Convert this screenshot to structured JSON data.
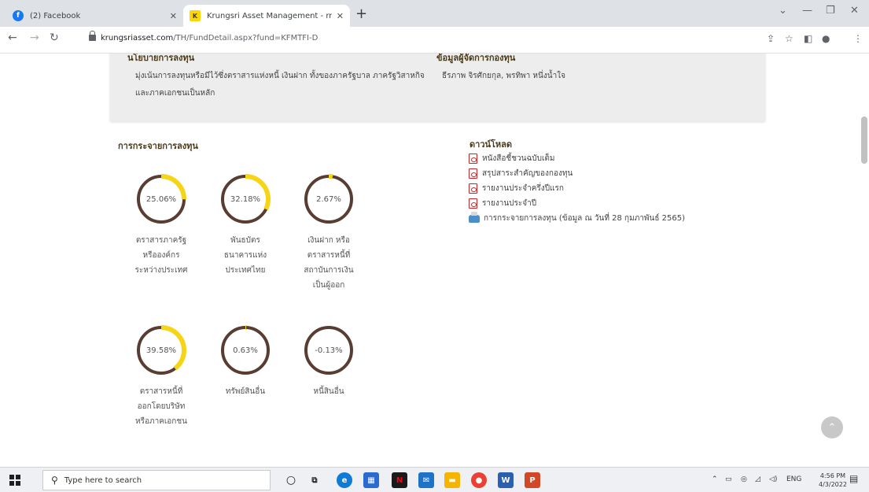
{
  "browser": {
    "tabs": [
      {
        "title": "(2) Facebook",
        "active": false
      },
      {
        "title": "Krungsri Asset Management - rr",
        "active": true
      }
    ],
    "url_host": "krungsriasset.com",
    "url_path": "/TH/FundDetail.aspx?fund=KFMTFI-D"
  },
  "policy": {
    "title": "นโยบายการลงทุน",
    "text": "มุ่งเน้นการลงทุนหรือมีไว้ซึ่งตราสารแห่งหนี้ เงินฝาก ทั้งของภาครัฐบาล ภาครัฐวิสาหกิจ และภาคเอกชนเป็นหลัก"
  },
  "manager": {
    "title": "ข้อมูลผู้จัดการกองทุน",
    "text": "ธีรภาพ จิรศักยกุล, พรทิพา หนึ่งน้ำใจ"
  },
  "allocation": {
    "title": "การกระจายการลงทุน",
    "items": [
      {
        "pct_label": "25.06%",
        "value": 25.06,
        "label_lines": [
          "ตราสารภาครัฐ",
          "หรือองค์กร",
          "ระหว่างประเทศ"
        ]
      },
      {
        "pct_label": "32.18%",
        "value": 32.18,
        "label_lines": [
          "พันธบัตร",
          "ธนาคารแห่ง",
          "ประเทศไทย"
        ]
      },
      {
        "pct_label": "2.67%",
        "value": 2.67,
        "label_lines": [
          "เงินฝาก หรือ",
          "ตราสารหนี้ที่",
          "สถาบันการเงิน",
          "เป็นผู้ออก"
        ]
      },
      {
        "pct_label": "39.58%",
        "value": 39.58,
        "label_lines": [
          "ตราสารหนี้ที่",
          "ออกโดยบริษัท",
          "หรือภาคเอกชน"
        ]
      },
      {
        "pct_label": "0.63%",
        "value": 0.63,
        "label_lines": [
          "ทรัพย์สินอื่น"
        ]
      },
      {
        "pct_label": "-0.13%",
        "value": -0.13,
        "label_lines": [
          "หนี้สินอื่น"
        ]
      }
    ],
    "colors": {
      "fill": "#f6d416",
      "track": "#5a3d32"
    }
  },
  "downloads": {
    "title": "ดาวน์โหลด",
    "items": [
      {
        "label": "หนังสือชี้ชวนฉบับเต็ม",
        "icon": "pdf-icon"
      },
      {
        "label": "สรุปสาระสำคัญของกองทุน",
        "icon": "pdf-icon"
      },
      {
        "label": "รายงานประจำครึ่งปีแรก",
        "icon": "pdf-icon"
      },
      {
        "label": "รายงานประจำปี",
        "icon": "pdf-icon"
      },
      {
        "label": "การกระจายการลงทุน (ข้อมูล ณ วันที่ 28 กุมภาพันธ์ 2565)",
        "icon": "spreadsheet-icon"
      }
    ]
  },
  "taskbar": {
    "search_placeholder": "Type here to search",
    "lang": "ENG",
    "time": "4:56 PM",
    "date": "4/3/2022"
  }
}
